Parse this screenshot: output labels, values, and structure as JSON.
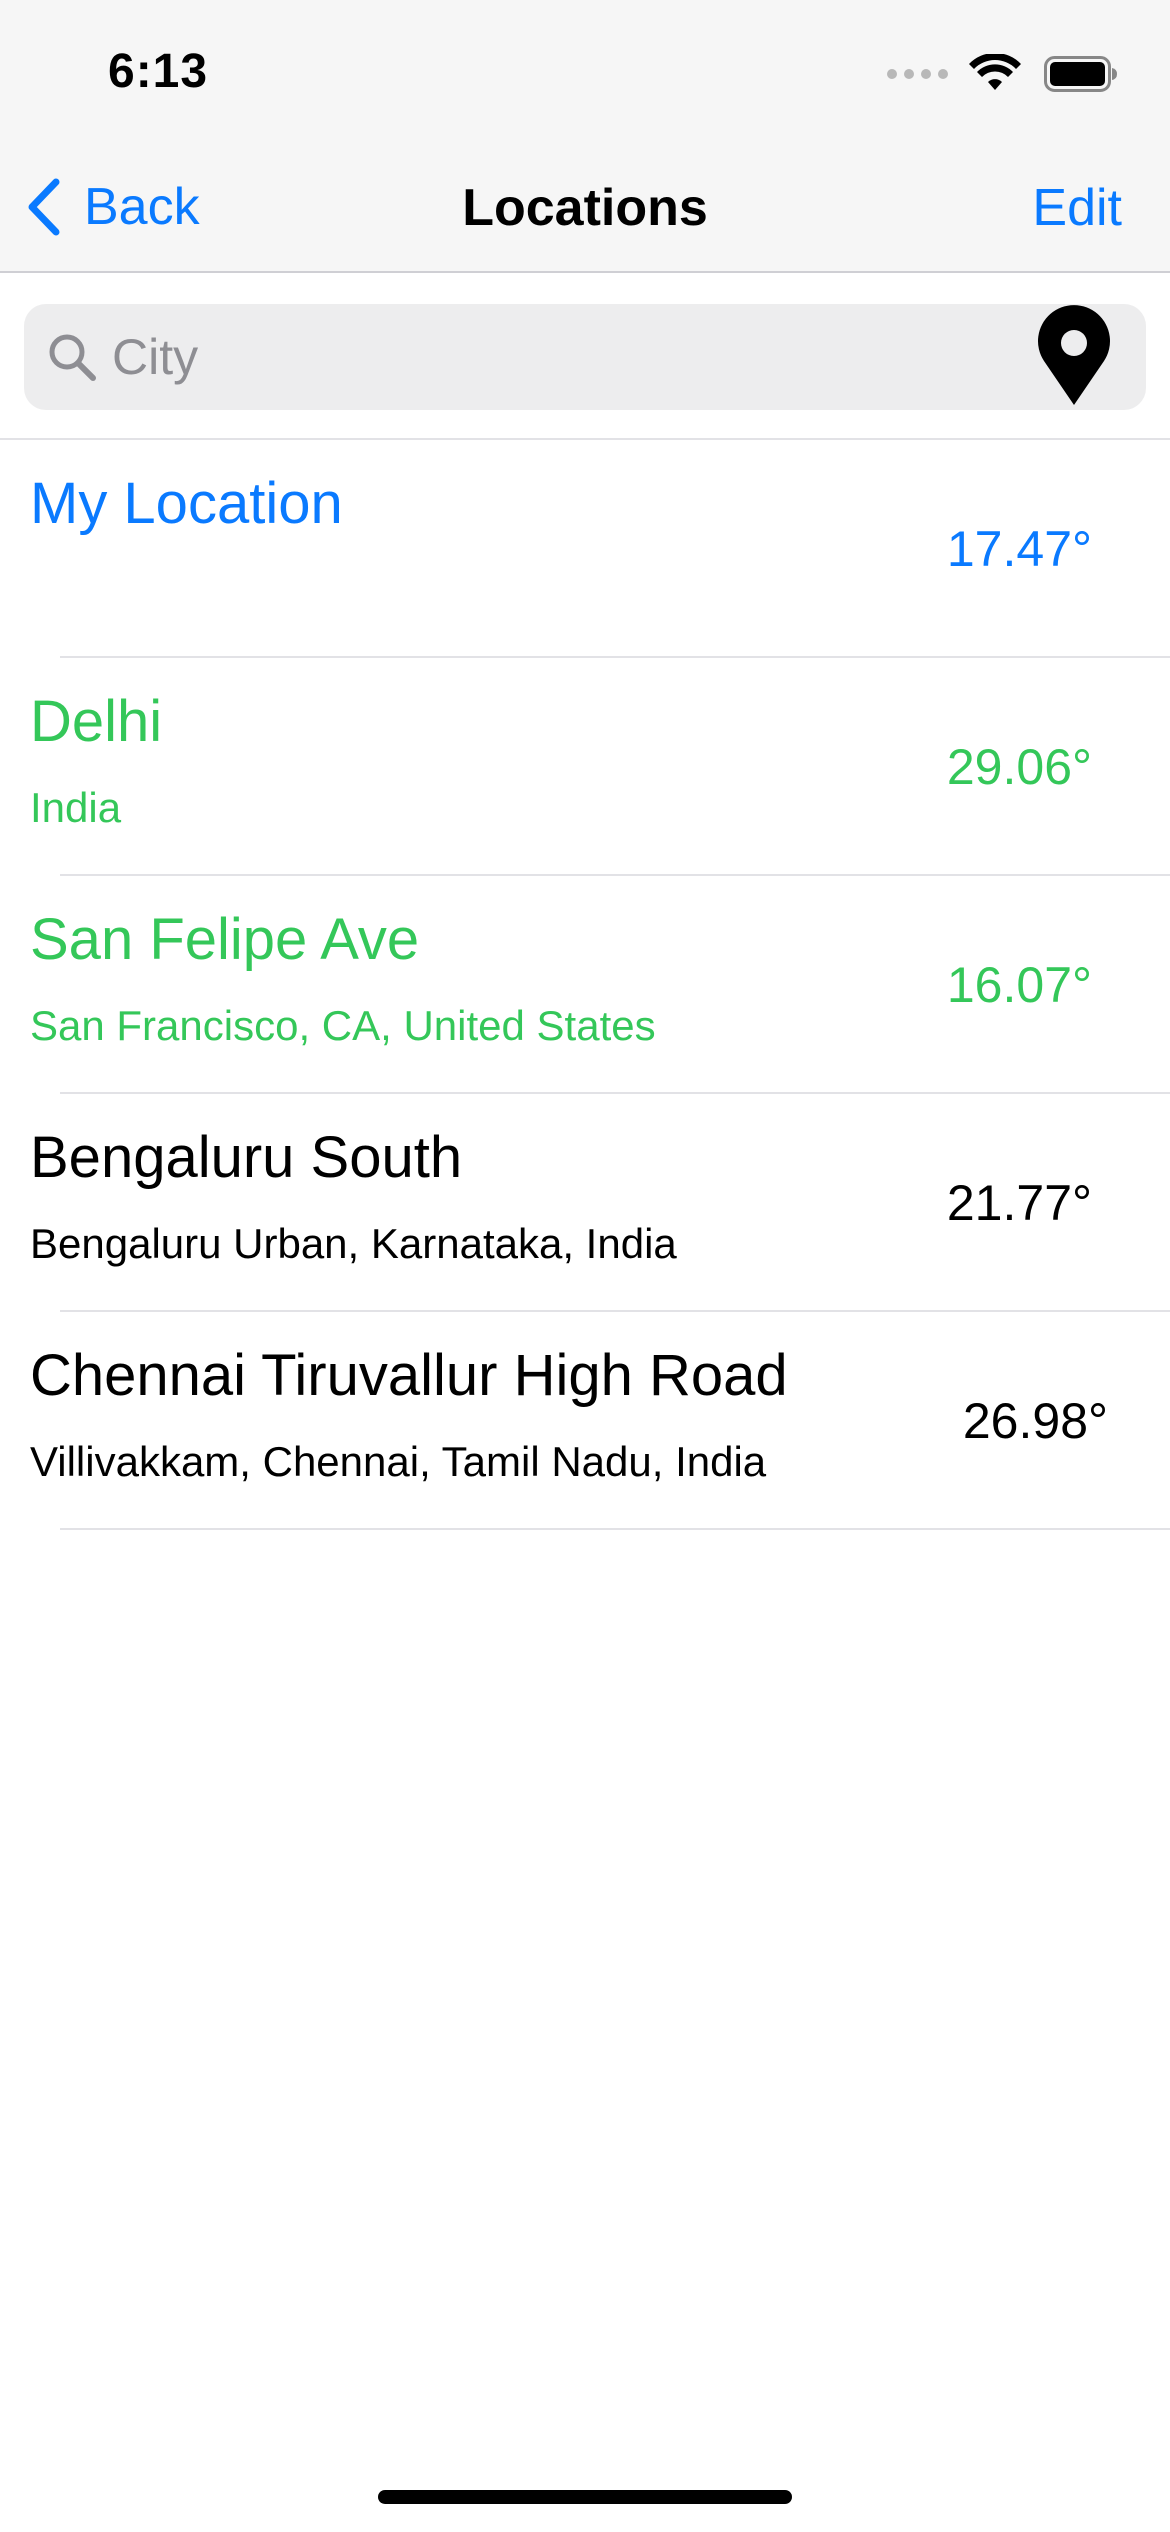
{
  "status_bar": {
    "time": "6:13",
    "signal_icon": "cellular-signal-icon",
    "wifi_icon": "wifi-icon",
    "battery_icon": "battery-icon"
  },
  "nav": {
    "back_label": "Back",
    "title": "Locations",
    "edit_label": "Edit"
  },
  "search": {
    "placeholder": "City",
    "value": "",
    "search_icon": "magnifying-glass-icon",
    "location_icon": "location-pin-icon"
  },
  "colors": {
    "accent": "#0a7aff",
    "green": "#34c759",
    "text": "#000000"
  },
  "locations": [
    {
      "title": "My Location",
      "subtitle": "",
      "temp": "17.47°",
      "color": "#0a7aff"
    },
    {
      "title": "Delhi",
      "subtitle": "India",
      "temp": "29.06°",
      "color": "#34c759"
    },
    {
      "title": "San Felipe Ave",
      "subtitle": "San Francisco, CA, United States",
      "temp": "16.07°",
      "color": "#34c759"
    },
    {
      "title": "Bengaluru South",
      "subtitle": "Bengaluru Urban, Karnataka, India",
      "temp": "21.77°",
      "color": "#000000"
    },
    {
      "title": "Chennai Tiruvallur High Road",
      "subtitle": "Villivakkam, Chennai, Tamil Nadu, India",
      "temp": "26.98°",
      "color": "#000000"
    }
  ]
}
